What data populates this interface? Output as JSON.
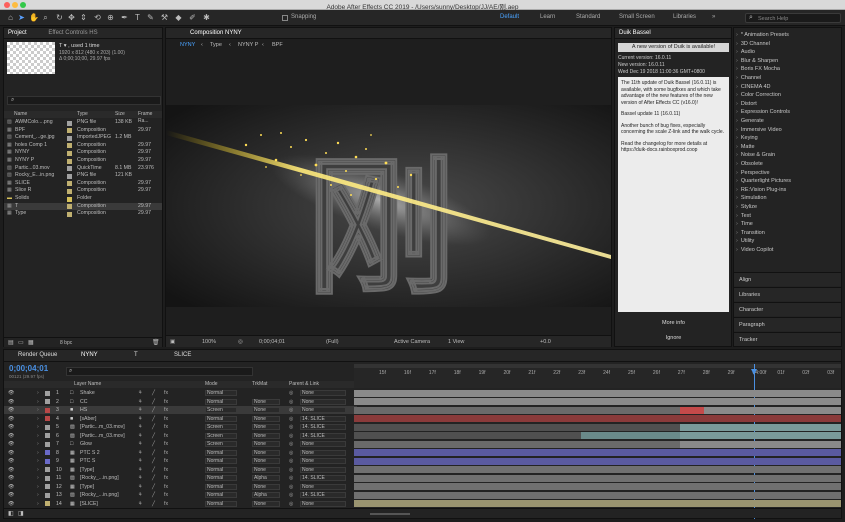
{
  "window": {
    "title": "Adobe After Effects CC 2019 - /Users/sunny/Desktop/JJ/AE/刚.aep"
  },
  "toolbar": {
    "snapping_label": "Snapping",
    "workspaces": [
      "Default",
      "Learn",
      "Standard",
      "Small Screen",
      "Libraries"
    ],
    "active_workspace": "Default",
    "search_placeholder": "Search Help"
  },
  "project_panel": {
    "tab_project": "Project",
    "tab_effect_controls": "Effect Controls HS",
    "selected_name": "T ▾ , used 1 time",
    "selected_info1": "1920 x 812 (480 x 203) (1.00)",
    "selected_info2": "Δ 0;00;10;00, 29.97 fps",
    "search_placeholder": "⌕",
    "columns": [
      "Name",
      "Type",
      "Size",
      "Frame Ra..."
    ],
    "items": [
      {
        "name": "AWMColo....png",
        "type": "PNG file",
        "size": "138 KB",
        "fr": "",
        "color": "#a1a1a1",
        "kind": "img"
      },
      {
        "name": "BPF",
        "type": "Composition",
        "size": "",
        "fr": "29.97",
        "color": "#c0b070",
        "kind": "comp"
      },
      {
        "name": "Cement_...ge.jpg",
        "type": "ImportedJPEG",
        "size": "1.2 MB",
        "fr": "",
        "color": "#a1a1a1",
        "kind": "img"
      },
      {
        "name": "holes Comp 1",
        "type": "Composition",
        "size": "",
        "fr": "29.97",
        "color": "#c0b070",
        "kind": "comp"
      },
      {
        "name": "NYNY",
        "type": "Composition",
        "size": "",
        "fr": "29.97",
        "color": "#c0b070",
        "kind": "comp"
      },
      {
        "name": "NYNY P",
        "type": "Composition",
        "size": "",
        "fr": "29.97",
        "color": "#c0b070",
        "kind": "comp"
      },
      {
        "name": "Partic...03.mov",
        "type": "QuickTime",
        "size": "8.1 MB",
        "fr": "23.976",
        "color": "#a1a1a1",
        "kind": "img"
      },
      {
        "name": "Rocky_E...in.png",
        "type": "PNG file",
        "size": "121 KB",
        "fr": "",
        "color": "#a1a1a1",
        "kind": "img"
      },
      {
        "name": "SLICE",
        "type": "Composition",
        "size": "",
        "fr": "29.97",
        "color": "#c0b070",
        "kind": "comp"
      },
      {
        "name": "Slice R",
        "type": "Composition",
        "size": "",
        "fr": "29.97",
        "color": "#c0b070",
        "kind": "comp"
      },
      {
        "name": "Solids",
        "type": "Folder",
        "size": "",
        "fr": "",
        "color": "#d6c15a",
        "kind": "folder"
      },
      {
        "name": "T",
        "type": "Composition",
        "size": "",
        "fr": "29.97",
        "color": "#c0b070",
        "kind": "comp"
      },
      {
        "name": "Type",
        "type": "Composition",
        "size": "",
        "fr": "29.97",
        "color": "#c0b070",
        "kind": "comp"
      }
    ],
    "bpc": "8 bpc"
  },
  "composition_panel": {
    "tab": "Composition NYNY",
    "breadcrumbs": [
      "NYNY",
      "Type",
      "NYNY P",
      "BPF"
    ],
    "zoom": "100%",
    "timecode": "0;00;04;01",
    "resolution": "(Full)",
    "camera": "Active Camera",
    "view": "1 View",
    "exposure": "+0.0",
    "glyph": "刚"
  },
  "duik_panel": {
    "tab": "Duik Bassel",
    "banner": "A new version of Duik is available!",
    "current_version": "Current version: 16.0.11",
    "new_version": "New version: 16.0.11",
    "date": "Wed Dec 19 2018 11:00:36 GMT+0800",
    "para1": "The 11th update of Duik Bassel (16.0.11) is available, with some bugfixes and which take advantage of the new features of the new version of After Effects CC (v16.0)!",
    "para2": "Bassel update 11 (16.0.11)",
    "para3": "Another bunch of bug fixes, especially concerning the scale Z-link and the walk cycle.",
    "para4": "Read the changelog for more details at https://duik-docs.rainboxprod.coop",
    "more_info": "More info",
    "ignore": "Ignore"
  },
  "effects_panel": {
    "categories": [
      "* Animation Presets",
      "3D Channel",
      "Audio",
      "Blur & Sharpen",
      "Boris FX Mocha",
      "Channel",
      "CINEMA 4D",
      "Color Correction",
      "Distort",
      "Expression Controls",
      "Generate",
      "Immersive Video",
      "Keying",
      "Matte",
      "Noise & Grain",
      "Obsolete",
      "Perspective",
      "Quarterlight Pictures",
      "RE:Vision Plug-ins",
      "Simulation",
      "Stylize",
      "Text",
      "Time",
      "Transition",
      "Utility",
      "Video Copilot"
    ],
    "panels": [
      "Align",
      "Libraries",
      "Character",
      "Paragraph",
      "Tracker"
    ]
  },
  "timeline": {
    "tabs": [
      "Render Queue",
      "NYNY",
      "T",
      "SLICE"
    ],
    "timecode": "0;00;04;01",
    "timecode_sub": "00121 (29.97 fps)",
    "headers": {
      "name": "Layer Name",
      "mode": "Mode",
      "trkmat": "TrkMat",
      "parent": "Parent & Link"
    },
    "ruler": [
      "15f",
      "16f",
      "17f",
      "18f",
      "19f",
      "20f",
      "21f",
      "22f",
      "23f",
      "24f",
      "25f",
      "26f",
      "27f",
      "28f",
      "29f",
      "04:00f",
      "01f",
      "02f",
      "03f",
      "04f"
    ],
    "layers": [
      {
        "num": "1",
        "name": "Shake",
        "label": "#a0a0a0",
        "mode": "Normal",
        "trk": "",
        "parent": "None",
        "type": "null"
      },
      {
        "num": "2",
        "name": "CC",
        "label": "#a0a0a0",
        "mode": "Normal",
        "trk": "None",
        "parent": "None",
        "type": "null"
      },
      {
        "num": "3",
        "name": "HS",
        "label": "#b84848",
        "mode": "Screen",
        "trk": "None",
        "parent": "None",
        "type": "solid"
      },
      {
        "num": "4",
        "name": "[sAber]",
        "label": "#b84848",
        "mode": "Normal",
        "trk": "None",
        "parent": "14. SLICE",
        "type": "solid"
      },
      {
        "num": "5",
        "name": "[Partic...m_03.mov]",
        "label": "#a0a0a0",
        "mode": "Screen",
        "trk": "None",
        "parent": "14. SLICE",
        "type": "footage"
      },
      {
        "num": "6",
        "name": "[Partic...m_03.mov]",
        "label": "#a0a0a0",
        "mode": "Screen",
        "trk": "None",
        "parent": "14. SLICE",
        "type": "footage"
      },
      {
        "num": "7",
        "name": "Glow",
        "label": "#a0a0a0",
        "mode": "Screen",
        "trk": "None",
        "parent": "None",
        "type": "null"
      },
      {
        "num": "8",
        "name": "PTC S 2",
        "label": "#6a6ac8",
        "mode": "Normal",
        "trk": "None",
        "parent": "None",
        "type": "comp"
      },
      {
        "num": "9",
        "name": "PTC S",
        "label": "#6a6ac8",
        "mode": "Normal",
        "trk": "None",
        "parent": "None",
        "type": "comp"
      },
      {
        "num": "10",
        "name": "[Type]",
        "label": "#a0a0a0",
        "mode": "Normal",
        "trk": "None",
        "parent": "None",
        "type": "comp"
      },
      {
        "num": "11",
        "name": "[Rocky_...in.png]",
        "label": "#a0a0a0",
        "mode": "Normal",
        "trk": "Alpha",
        "parent": "14. SLICE",
        "type": "footage"
      },
      {
        "num": "12",
        "name": "[Type]",
        "label": "#a0a0a0",
        "mode": "Normal",
        "trk": "None",
        "parent": "None",
        "type": "comp"
      },
      {
        "num": "13",
        "name": "[Rocky_...in.png]",
        "label": "#a0a0a0",
        "mode": "Normal",
        "trk": "Alpha",
        "parent": "14. SLICE",
        "type": "footage"
      },
      {
        "num": "14",
        "name": "[SLICE]",
        "label": "#c0b070",
        "mode": "Normal",
        "trk": "None",
        "parent": "None",
        "type": "comp"
      }
    ]
  },
  "colors": {
    "accent": "#2d8ceb",
    "playhead": "#4a90e2",
    "panel_bg": "#232323"
  }
}
